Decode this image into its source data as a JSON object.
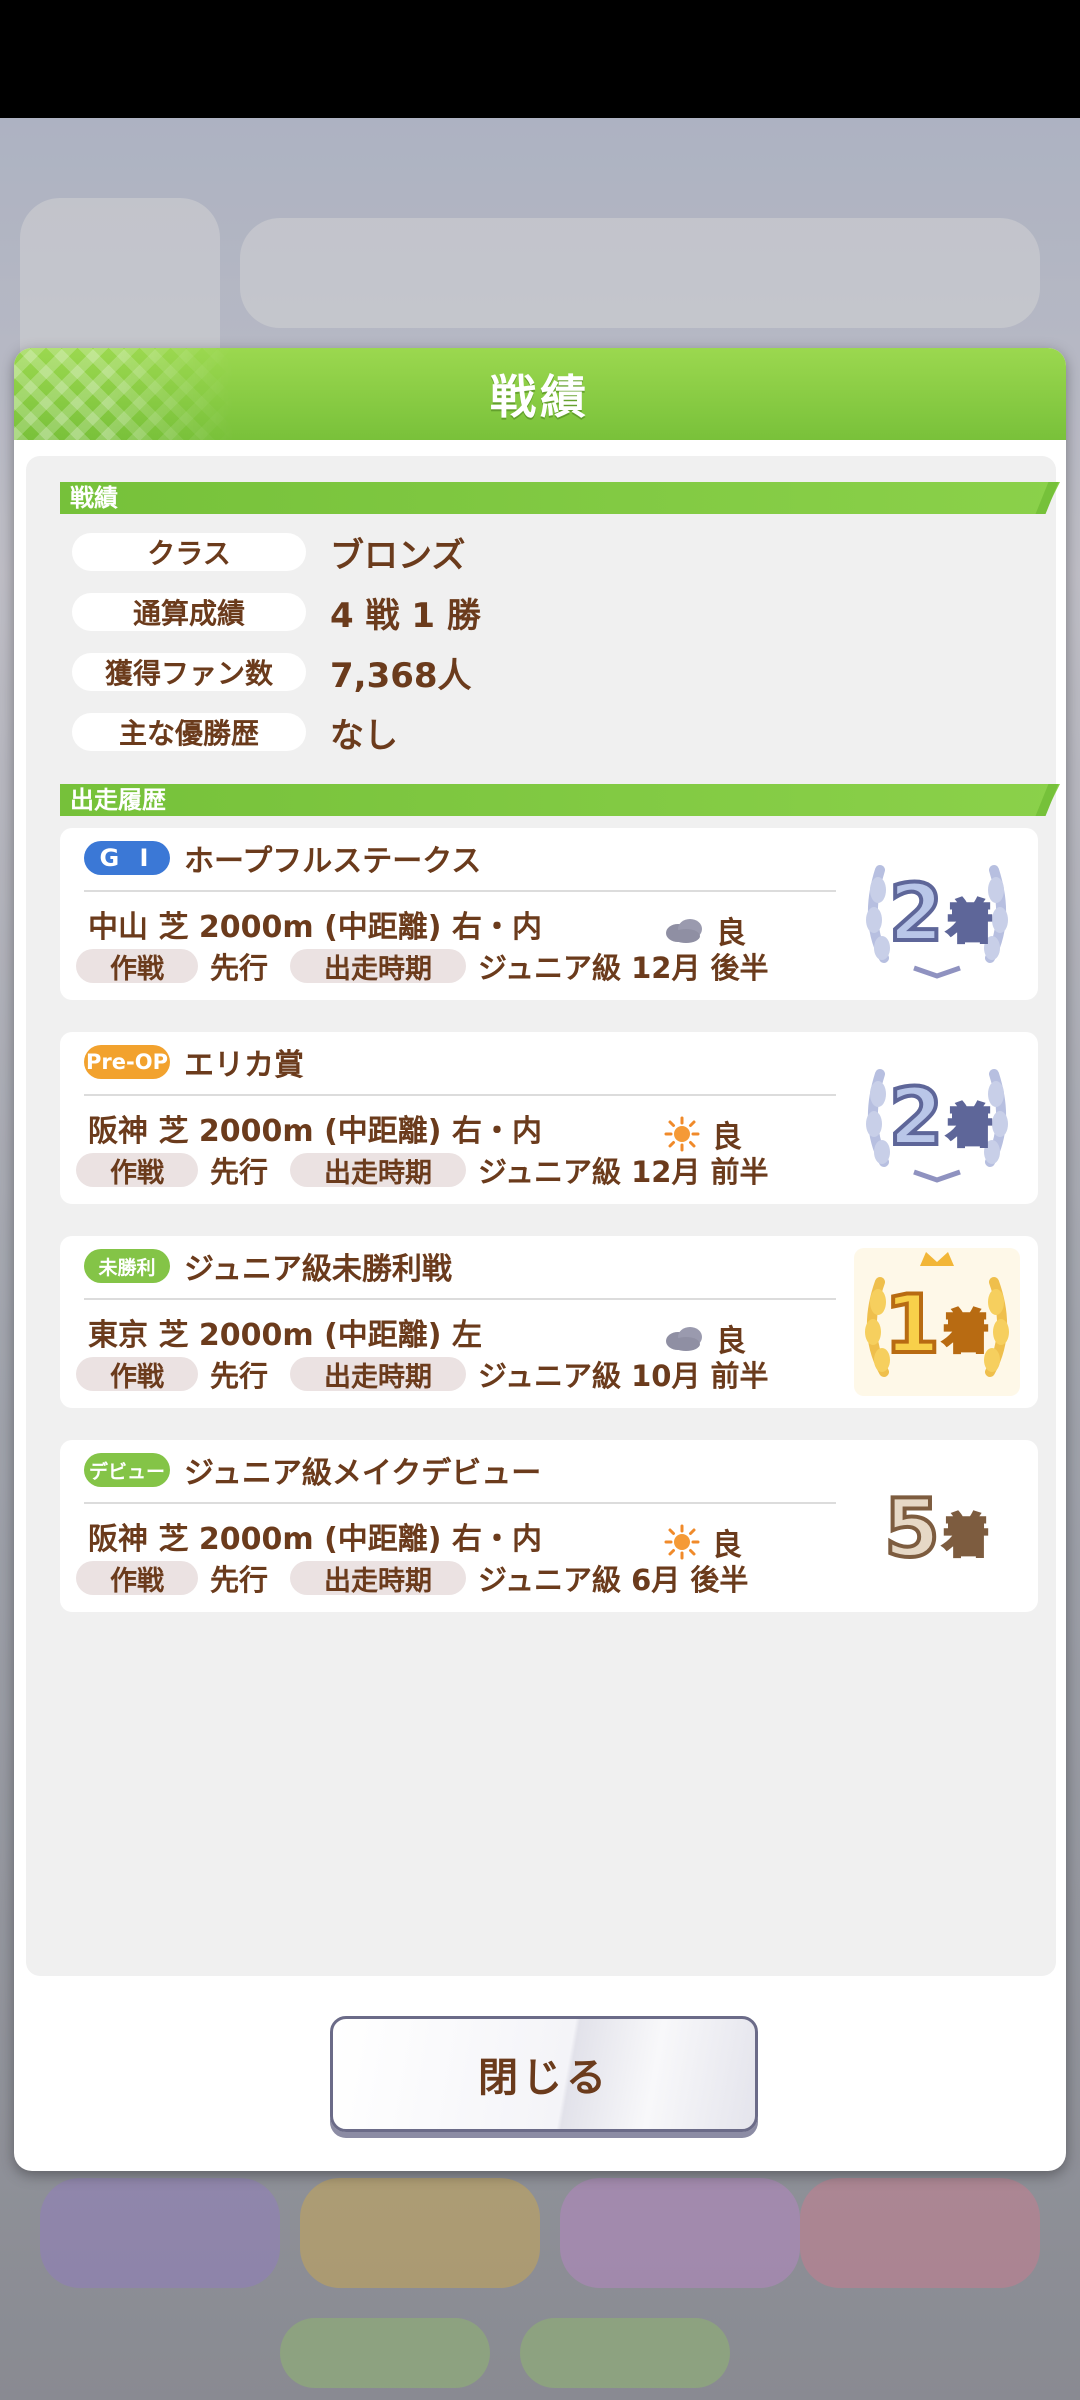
{
  "dialog": {
    "title": "戦績",
    "close_label": "閉じる"
  },
  "record_section": {
    "label": "戦績",
    "rows": [
      {
        "key": "クラス",
        "value": "ブロンズ"
      },
      {
        "key": "通算成績",
        "value": "4 戦 1 勝"
      },
      {
        "key": "獲得ファン数",
        "value": "7,368人"
      },
      {
        "key": "主な優勝歴",
        "value": "なし"
      }
    ]
  },
  "history_section": {
    "label": "出走履歴",
    "races": [
      {
        "grade": "G I",
        "name": "ホープフルステークス",
        "detail": "中山 芝 2000m (中距離) 右・内",
        "weather_icon": "cloudy-icon",
        "condition": "良",
        "strategy_label": "作戦",
        "strategy": "先行",
        "period_label": "出走時期",
        "period": "ジュニア級 12月 後半",
        "place_number": "2",
        "place_suffix": "着",
        "place_style": "silver"
      },
      {
        "grade": "Pre-OP",
        "name": "エリカ賞",
        "detail": "阪神 芝 2000m (中距離) 右・内",
        "weather_icon": "sunny-icon",
        "condition": "良",
        "strategy_label": "作戦",
        "strategy": "先行",
        "period_label": "出走時期",
        "period": "ジュニア級 12月 前半",
        "place_number": "2",
        "place_suffix": "着",
        "place_style": "silver"
      },
      {
        "grade": "未勝利",
        "name": "ジュニア級未勝利戦",
        "detail": "東京 芝 2000m (中距離) 左",
        "weather_icon": "cloudy-icon",
        "condition": "良",
        "strategy_label": "作戦",
        "strategy": "先行",
        "period_label": "出走時期",
        "period": "ジュニア級 10月 前半",
        "place_number": "1",
        "place_suffix": "着",
        "place_style": "gold"
      },
      {
        "grade": "デビュー",
        "name": "ジュニア級メイクデビュー",
        "detail": "阪神 芝 2000m (中距離) 右・内",
        "weather_icon": "sunny-icon",
        "condition": "良",
        "strategy_label": "作戦",
        "strategy": "先行",
        "period_label": "出走時期",
        "period": "ジュニア級 6月 後半",
        "place_number": "5",
        "place_suffix": "着",
        "place_style": "plain"
      }
    ]
  },
  "colors": {
    "header_green": "#79c13a",
    "text_brown": "#6b3b1c",
    "grade_g1": "#3b78d6",
    "grade_preop": "#f2a22e",
    "grade_junior": "#84c447"
  }
}
